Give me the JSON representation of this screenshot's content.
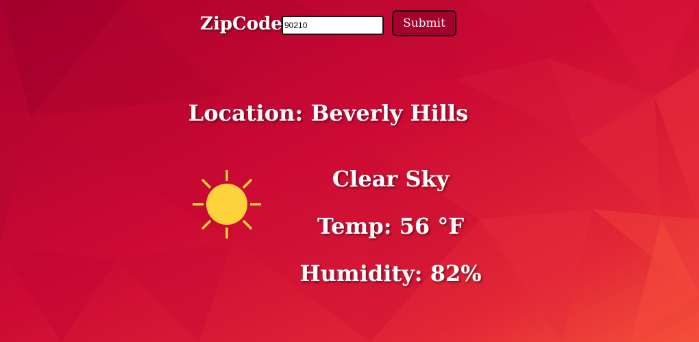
{
  "form": {
    "zip_label": "ZipCode:",
    "zip_value": "90210",
    "submit_label": "Submit"
  },
  "weather": {
    "location": "Location: Beverly Hills",
    "description": "Clear Sky",
    "temperature": "Temp: 56 °F",
    "humidity": "Humidity: 82%",
    "icon": "sun-icon"
  },
  "colors": {
    "background_dark": "#a8002e",
    "background_mid": "#cc0a34",
    "background_light": "#f0463a",
    "sun": "#fdd23a",
    "submit_bg": "#a4002c"
  }
}
